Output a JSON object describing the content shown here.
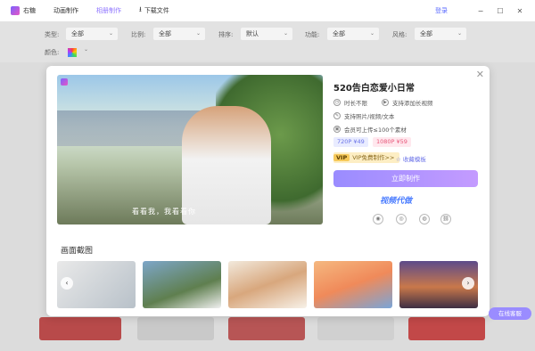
{
  "app": {
    "name": "右糖"
  },
  "nav": {
    "items": [
      {
        "label": "动画制作"
      },
      {
        "label": "相册制作"
      },
      {
        "label": "下载文件"
      }
    ]
  },
  "topbar": {
    "login": "登录",
    "minimize": "−",
    "maximize": "☐",
    "close": "✕"
  },
  "filters": {
    "type_label": "类型:",
    "type_value": "全部",
    "ratio_label": "比例:",
    "ratio_value": "全部",
    "sort_label": "排序:",
    "sort_value": "默认",
    "func_label": "功能:",
    "func_value": "全部",
    "style_label": "风格:",
    "style_value": "全部",
    "color_label": "颜色:"
  },
  "modal": {
    "title": "520告白恋爱小日常",
    "close": "✕",
    "features": [
      {
        "icon": "clock-icon",
        "text": "时长不限"
      },
      {
        "icon": "video-icon",
        "text": "支持添加长视频"
      },
      {
        "icon": "edit-icon",
        "text": "支持照片/视频/文本"
      },
      {
        "icon": "image-icon",
        "text": "会员可上传≤100个素材"
      }
    ],
    "prices": [
      {
        "label": "720P ¥49"
      },
      {
        "label": "1080P ¥59"
      }
    ],
    "vip_badge": "VIP",
    "vip_text": "VIP免费制作>>",
    "favorite": "☆ 收藏模板",
    "make_button": "立即制作",
    "promo": "视频代做"
  },
  "preview": {
    "caption": "看看我，我看看你"
  },
  "screenshots": {
    "title": "画面截图"
  },
  "service": {
    "label": "在线客服"
  }
}
